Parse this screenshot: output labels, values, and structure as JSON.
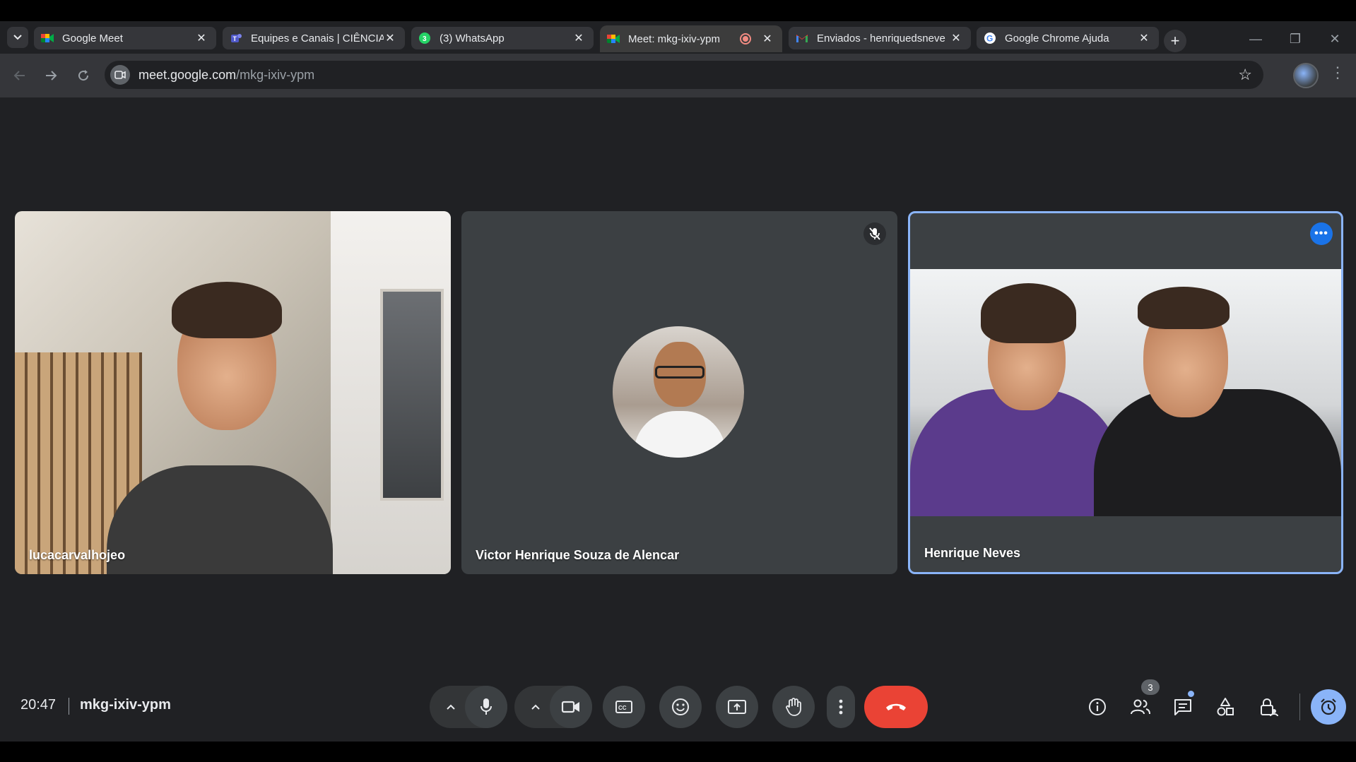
{
  "browser": {
    "tabs": [
      {
        "title": "Google Meet",
        "favicon": "meet-icon"
      },
      {
        "title": "Equipes e Canais | CIÊNCIA",
        "favicon": "teams-icon"
      },
      {
        "title": "(3) WhatsApp",
        "favicon": "whatsapp-icon",
        "badge": "3"
      },
      {
        "title": "Meet: mkg-ixiv-ypm",
        "favicon": "meet-icon",
        "active": true,
        "recording": true
      },
      {
        "title": "Enviados - henriquedsneve",
        "favicon": "gmail-icon"
      },
      {
        "title": "Google Chrome Ajuda",
        "favicon": "google-icon"
      }
    ],
    "address": {
      "host": "meet.google.com",
      "path": "/mkg-ixiv-ypm"
    }
  },
  "meet": {
    "participants": [
      {
        "name": "lucacarvalhojeo",
        "video": true
      },
      {
        "name": "Victor Henrique Souza de Alencar",
        "video": false,
        "muted": true
      },
      {
        "name": "Henrique Neves",
        "video": true,
        "active_speaker": true
      }
    ],
    "footer": {
      "time": "20:47",
      "meeting_code": "mkg-ixiv-ypm",
      "people_count": "3"
    }
  },
  "colors": {
    "accent": "#8ab4f8",
    "end_call": "#ea4335",
    "stage_bg": "#202124",
    "tile_bg": "#3c4043"
  }
}
